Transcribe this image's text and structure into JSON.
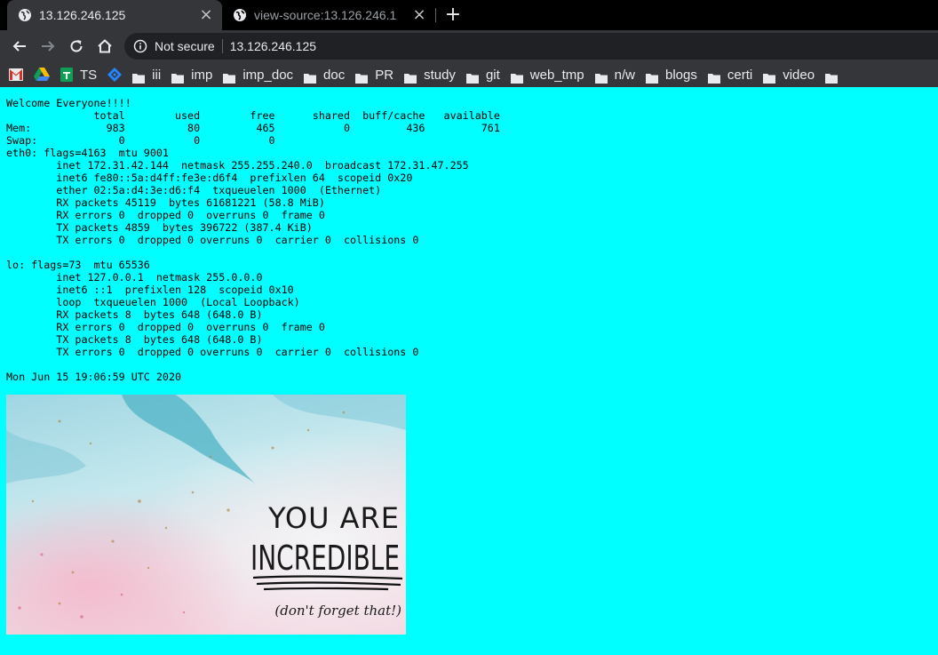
{
  "tabs": [
    {
      "title": "13.126.246.125",
      "active": true
    },
    {
      "title": "view-source:13.126.246.1",
      "active": false
    }
  ],
  "omnibox": {
    "security_label": "Not secure",
    "url": "13.126.246.125"
  },
  "bookmarks": [
    {
      "label": "",
      "icon": "gmail-icon"
    },
    {
      "label": "",
      "icon": "drive-icon"
    },
    {
      "label": "TS",
      "icon": "sheets-icon"
    },
    {
      "label": "",
      "icon": "jira-icon"
    },
    {
      "label": "iii",
      "icon": "folder-icon"
    },
    {
      "label": "imp",
      "icon": "folder-icon"
    },
    {
      "label": "imp_doc",
      "icon": "folder-icon"
    },
    {
      "label": "doc",
      "icon": "folder-icon"
    },
    {
      "label": "PR",
      "icon": "folder-icon"
    },
    {
      "label": "study",
      "icon": "folder-icon"
    },
    {
      "label": "git",
      "icon": "folder-icon"
    },
    {
      "label": "web_tmp",
      "icon": "folder-icon"
    },
    {
      "label": "n/w",
      "icon": "folder-icon"
    },
    {
      "label": "blogs",
      "icon": "folder-icon"
    },
    {
      "label": "certi",
      "icon": "folder-icon"
    },
    {
      "label": "video",
      "icon": "folder-icon"
    }
  ],
  "page": {
    "output": "Welcome Everyone!!!!\n              total        used        free      shared  buff/cache   available\nMem:            983          80         465           0         436         761\nSwap:             0           0           0\neth0: flags=4163  mtu 9001\n        inet 172.31.42.144  netmask 255.255.240.0  broadcast 172.31.47.255\n        inet6 fe80::5a:d4ff:fe3e:d6f4  prefixlen 64  scopeid 0x20\n        ether 02:5a:d4:3e:d6:f4  txqueuelen 1000  (Ethernet)\n        RX packets 45119  bytes 61681221 (58.8 MiB)\n        RX errors 0  dropped 0  overruns 0  frame 0\n        TX packets 4859  bytes 396722 (387.4 KiB)\n        TX errors 0  dropped 0 overruns 0  carrier 0  collisions 0\n\nlo: flags=73  mtu 65536\n        inet 127.0.0.1  netmask 255.0.0.0\n        inet6 ::1  prefixlen 128  scopeid 0x10\n        loop  txqueuelen 1000  (Local Loopback)\n        RX packets 8  bytes 648 (648.0 B)\n        RX errors 0  dropped 0  overruns 0  frame 0\n        TX packets 8  bytes 648 (648.0 B)\n        TX errors 0  dropped 0 overruns 0  carrier 0  collisions 0\n\nMon Jun 15 19:06:59 UTC 2020",
    "image": {
      "line1": "YOU ARE",
      "line2": "INCREDIBLE",
      "line3": "(don't forget that!)"
    }
  },
  "colors": {
    "page_bg": "#00ffff",
    "chrome_dark": "#35363a",
    "tabstrip": "#000000",
    "omnibox": "#202124"
  }
}
